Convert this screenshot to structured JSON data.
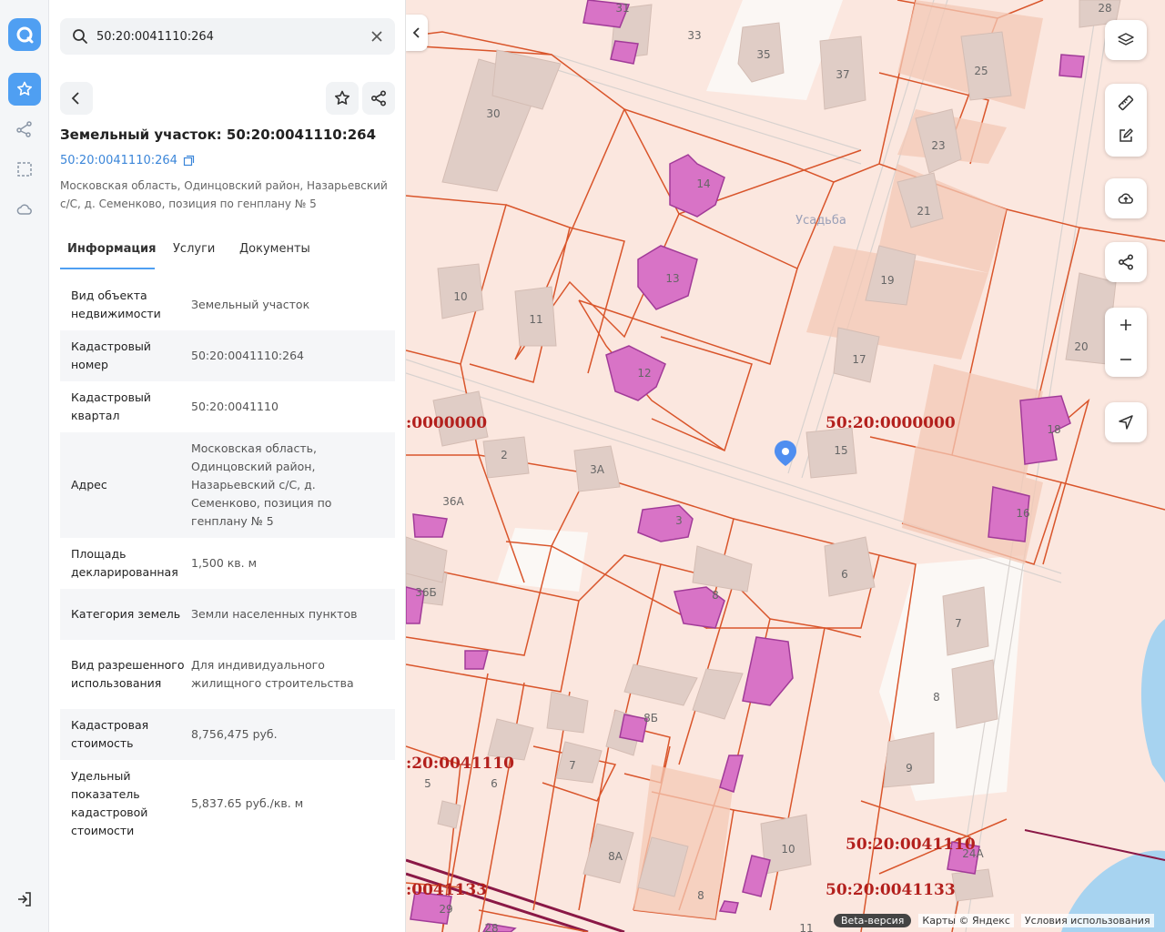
{
  "search": {
    "value": "50:20:0041110:264"
  },
  "parcel": {
    "title": "Земельный участок: 50:20:0041110:264",
    "cad_number": "50:20:0041110:264",
    "address": "Московская область, Одинцовский район, Назарьевский с/С, д. Семенково, позиция по генплану № 5"
  },
  "tabs": [
    "Информация",
    "Услуги",
    "Документы"
  ],
  "info_rows": [
    {
      "key": "Вид объекта недвижимости",
      "value": "Земельный участок"
    },
    {
      "key": "Кадастровый номер",
      "value": "50:20:0041110:264"
    },
    {
      "key": "Кадастровый квартал",
      "value": "50:20:0041110"
    },
    {
      "key": "Адрес",
      "value": "Московская область, Одинцовский район, Назарьевский с/С, д. Семенково, позиция по генплану № 5"
    },
    {
      "key": "Площадь декларированная",
      "value": "1,500 кв. м"
    },
    {
      "key": "Категория земель",
      "value": "Земли населенных пунктов"
    },
    {
      "key": "Вид разрешенного использования",
      "value": "Для индивидуального жилищного строительства"
    },
    {
      "key": "Кадастровая стоимость",
      "value": "8,756,475 руб."
    },
    {
      "key": "Удельный показатель кадастровой стоимости",
      "value": "5,837.65 руб./кв. м"
    }
  ],
  "map": {
    "area_label": "Усадьба",
    "quarter_labels": [
      "50:20:0000000",
      ":0000000",
      ":20:0041110",
      "50:20:0041110",
      "50:20:0041133",
      ":0041133"
    ],
    "house_numbers": [
      "31",
      "33",
      "35",
      "37",
      "28",
      "25",
      "30",
      "23",
      "14",
      "21",
      "10",
      "11",
      "13",
      "19",
      "20",
      "17",
      "12",
      "15",
      "18",
      "2",
      "3А",
      "36А",
      "3",
      "16",
      "6",
      "36Б",
      "8",
      "7",
      "8Б",
      "8",
      "7",
      "5",
      "6",
      "9",
      "8А",
      "10",
      "24А",
      "29",
      "28",
      "11"
    ]
  },
  "attribution": {
    "beta": "Beta-версия",
    "maps": "Карты © Яндекс",
    "terms": "Условия использования"
  },
  "colors": {
    "accent": "#4f9ff2",
    "parcel_stroke": "#d9552b",
    "building_highlight": "#d873c6",
    "quarter_label": "#b3201d",
    "water": "#a7d3f0"
  }
}
